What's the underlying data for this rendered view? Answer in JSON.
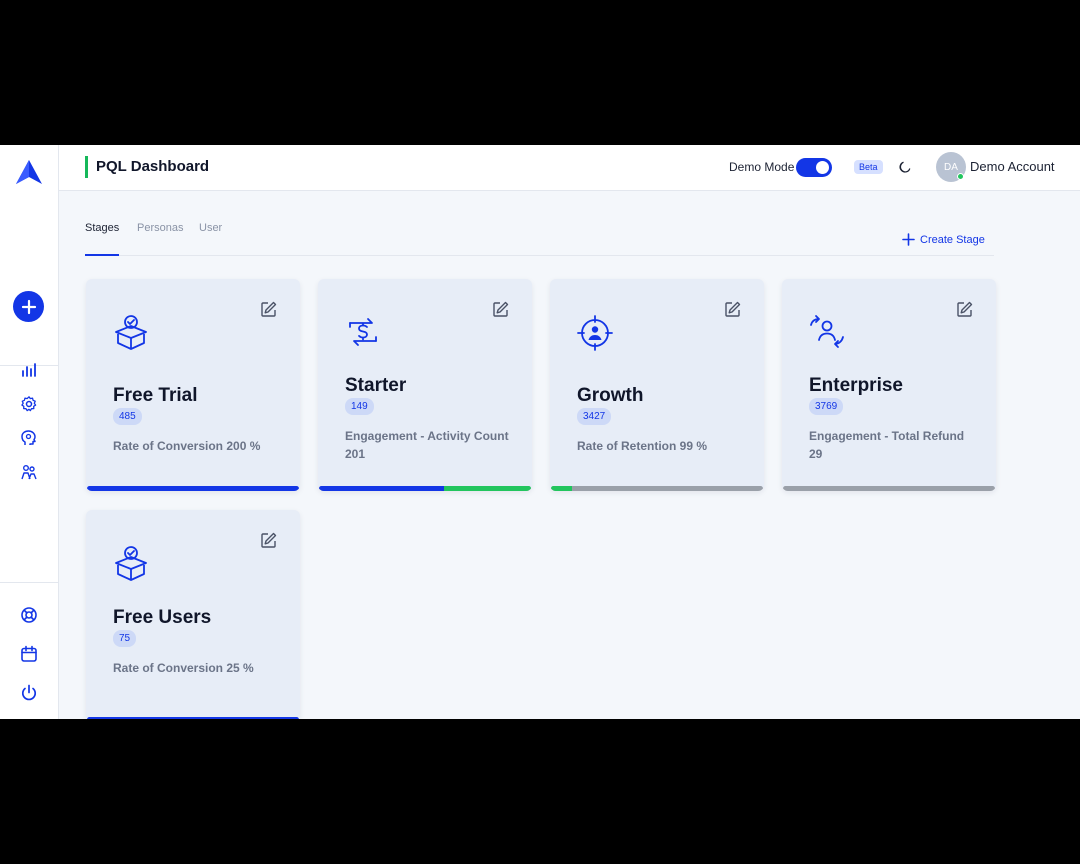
{
  "header": {
    "title": "PQL Dashboard",
    "demo_mode_label": "Demo Mode",
    "beta_label": "Beta",
    "avatar_initials": "DA",
    "account_name": "Demo Account"
  },
  "tabs": [
    {
      "label": "Stages",
      "active": true
    },
    {
      "label": "Personas",
      "active": false
    },
    {
      "label": "User",
      "active": false
    }
  ],
  "create_stage_label": "Create Stage",
  "colors": {
    "accent": "#1336e6",
    "success": "#16b85a",
    "track": "#9aa0a9"
  },
  "sidebar": {
    "icons": [
      "chart-icon",
      "settings-icon",
      "persona-icon",
      "users-icon",
      "support-icon",
      "calendar-icon",
      "power-icon"
    ]
  },
  "cards": [
    {
      "title": "Free Trial",
      "count": "485",
      "metric": "Rate of Conversion 200 %",
      "icon": "box-check-icon",
      "progress": [
        {
          "color": "#1336e6",
          "fraction": 1.0
        }
      ]
    },
    {
      "title": "Starter",
      "count": "149",
      "metric": "Engagement - Activity Count 201",
      "icon": "dollar-exchange-icon",
      "progress": [
        {
          "color": "#1336e6",
          "fraction": 0.59
        },
        {
          "color": "#22c55e",
          "fraction": 0.41
        }
      ]
    },
    {
      "title": "Growth",
      "count": "3427",
      "metric": "Rate of Retention 99 %",
      "icon": "target-user-icon",
      "progress": [
        {
          "color": "#22c55e",
          "fraction": 0.1
        }
      ]
    },
    {
      "title": "Enterprise",
      "count": "3769",
      "metric": "Engagement - Total Refund 29",
      "icon": "user-swap-icon",
      "progress": []
    },
    {
      "title": "Free Users",
      "count": "75",
      "metric": "Rate of Conversion 25 %",
      "icon": "box-check-icon",
      "progress": [
        {
          "color": "#1336e6",
          "fraction": 1.0
        }
      ]
    }
  ]
}
